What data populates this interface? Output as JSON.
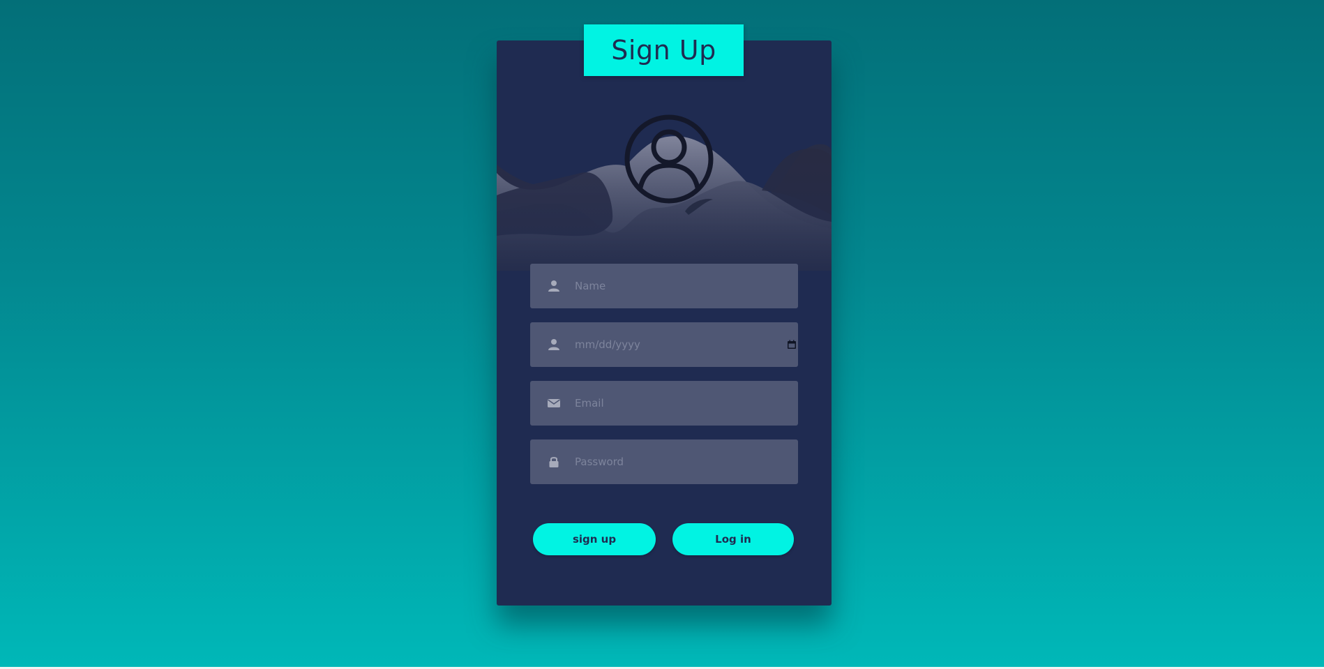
{
  "header": {
    "title": "Sign Up"
  },
  "form": {
    "name": {
      "placeholder": "Name",
      "icon": "user-icon"
    },
    "birthdate": {
      "placeholder": "mm/dd/yyyy",
      "icon": "user-icon"
    },
    "email": {
      "placeholder": "Email",
      "icon": "envelope-icon"
    },
    "password": {
      "placeholder": "Password",
      "icon": "lock-icon"
    }
  },
  "actions": {
    "signup_label": "sign up",
    "login_label": "Log in"
  },
  "colors": {
    "accent": "#01f3e3",
    "card": "#1f2b51",
    "field": "#4f5774"
  }
}
